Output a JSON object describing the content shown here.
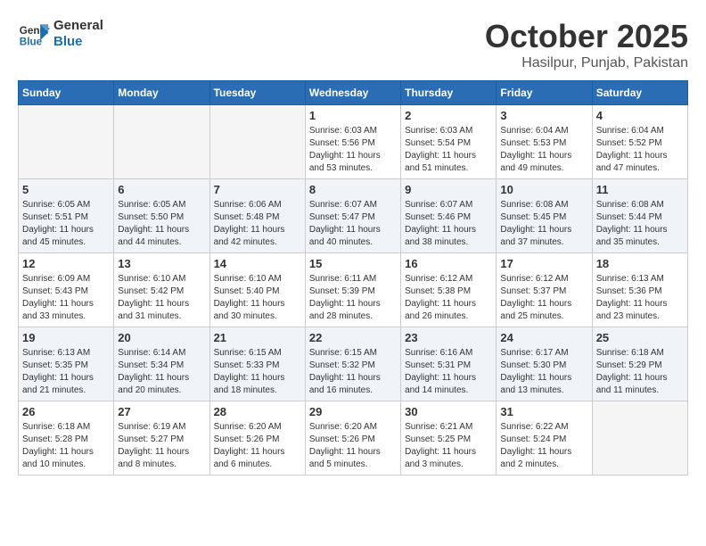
{
  "header": {
    "logo_line1": "General",
    "logo_line2": "Blue",
    "month": "October 2025",
    "location": "Hasilpur, Punjab, Pakistan"
  },
  "weekdays": [
    "Sunday",
    "Monday",
    "Tuesday",
    "Wednesday",
    "Thursday",
    "Friday",
    "Saturday"
  ],
  "weeks": [
    [
      {
        "day": "",
        "info": ""
      },
      {
        "day": "",
        "info": ""
      },
      {
        "day": "",
        "info": ""
      },
      {
        "day": "1",
        "info": "Sunrise: 6:03 AM\nSunset: 5:56 PM\nDaylight: 11 hours and 53 minutes."
      },
      {
        "day": "2",
        "info": "Sunrise: 6:03 AM\nSunset: 5:54 PM\nDaylight: 11 hours and 51 minutes."
      },
      {
        "day": "3",
        "info": "Sunrise: 6:04 AM\nSunset: 5:53 PM\nDaylight: 11 hours and 49 minutes."
      },
      {
        "day": "4",
        "info": "Sunrise: 6:04 AM\nSunset: 5:52 PM\nDaylight: 11 hours and 47 minutes."
      }
    ],
    [
      {
        "day": "5",
        "info": "Sunrise: 6:05 AM\nSunset: 5:51 PM\nDaylight: 11 hours and 45 minutes."
      },
      {
        "day": "6",
        "info": "Sunrise: 6:05 AM\nSunset: 5:50 PM\nDaylight: 11 hours and 44 minutes."
      },
      {
        "day": "7",
        "info": "Sunrise: 6:06 AM\nSunset: 5:48 PM\nDaylight: 11 hours and 42 minutes."
      },
      {
        "day": "8",
        "info": "Sunrise: 6:07 AM\nSunset: 5:47 PM\nDaylight: 11 hours and 40 minutes."
      },
      {
        "day": "9",
        "info": "Sunrise: 6:07 AM\nSunset: 5:46 PM\nDaylight: 11 hours and 38 minutes."
      },
      {
        "day": "10",
        "info": "Sunrise: 6:08 AM\nSunset: 5:45 PM\nDaylight: 11 hours and 37 minutes."
      },
      {
        "day": "11",
        "info": "Sunrise: 6:08 AM\nSunset: 5:44 PM\nDaylight: 11 hours and 35 minutes."
      }
    ],
    [
      {
        "day": "12",
        "info": "Sunrise: 6:09 AM\nSunset: 5:43 PM\nDaylight: 11 hours and 33 minutes."
      },
      {
        "day": "13",
        "info": "Sunrise: 6:10 AM\nSunset: 5:42 PM\nDaylight: 11 hours and 31 minutes."
      },
      {
        "day": "14",
        "info": "Sunrise: 6:10 AM\nSunset: 5:40 PM\nDaylight: 11 hours and 30 minutes."
      },
      {
        "day": "15",
        "info": "Sunrise: 6:11 AM\nSunset: 5:39 PM\nDaylight: 11 hours and 28 minutes."
      },
      {
        "day": "16",
        "info": "Sunrise: 6:12 AM\nSunset: 5:38 PM\nDaylight: 11 hours and 26 minutes."
      },
      {
        "day": "17",
        "info": "Sunrise: 6:12 AM\nSunset: 5:37 PM\nDaylight: 11 hours and 25 minutes."
      },
      {
        "day": "18",
        "info": "Sunrise: 6:13 AM\nSunset: 5:36 PM\nDaylight: 11 hours and 23 minutes."
      }
    ],
    [
      {
        "day": "19",
        "info": "Sunrise: 6:13 AM\nSunset: 5:35 PM\nDaylight: 11 hours and 21 minutes."
      },
      {
        "day": "20",
        "info": "Sunrise: 6:14 AM\nSunset: 5:34 PM\nDaylight: 11 hours and 20 minutes."
      },
      {
        "day": "21",
        "info": "Sunrise: 6:15 AM\nSunset: 5:33 PM\nDaylight: 11 hours and 18 minutes."
      },
      {
        "day": "22",
        "info": "Sunrise: 6:15 AM\nSunset: 5:32 PM\nDaylight: 11 hours and 16 minutes."
      },
      {
        "day": "23",
        "info": "Sunrise: 6:16 AM\nSunset: 5:31 PM\nDaylight: 11 hours and 14 minutes."
      },
      {
        "day": "24",
        "info": "Sunrise: 6:17 AM\nSunset: 5:30 PM\nDaylight: 11 hours and 13 minutes."
      },
      {
        "day": "25",
        "info": "Sunrise: 6:18 AM\nSunset: 5:29 PM\nDaylight: 11 hours and 11 minutes."
      }
    ],
    [
      {
        "day": "26",
        "info": "Sunrise: 6:18 AM\nSunset: 5:28 PM\nDaylight: 11 hours and 10 minutes."
      },
      {
        "day": "27",
        "info": "Sunrise: 6:19 AM\nSunset: 5:27 PM\nDaylight: 11 hours and 8 minutes."
      },
      {
        "day": "28",
        "info": "Sunrise: 6:20 AM\nSunset: 5:26 PM\nDaylight: 11 hours and 6 minutes."
      },
      {
        "day": "29",
        "info": "Sunrise: 6:20 AM\nSunset: 5:26 PM\nDaylight: 11 hours and 5 minutes."
      },
      {
        "day": "30",
        "info": "Sunrise: 6:21 AM\nSunset: 5:25 PM\nDaylight: 11 hours and 3 minutes."
      },
      {
        "day": "31",
        "info": "Sunrise: 6:22 AM\nSunset: 5:24 PM\nDaylight: 11 hours and 2 minutes."
      },
      {
        "day": "",
        "info": ""
      }
    ]
  ]
}
